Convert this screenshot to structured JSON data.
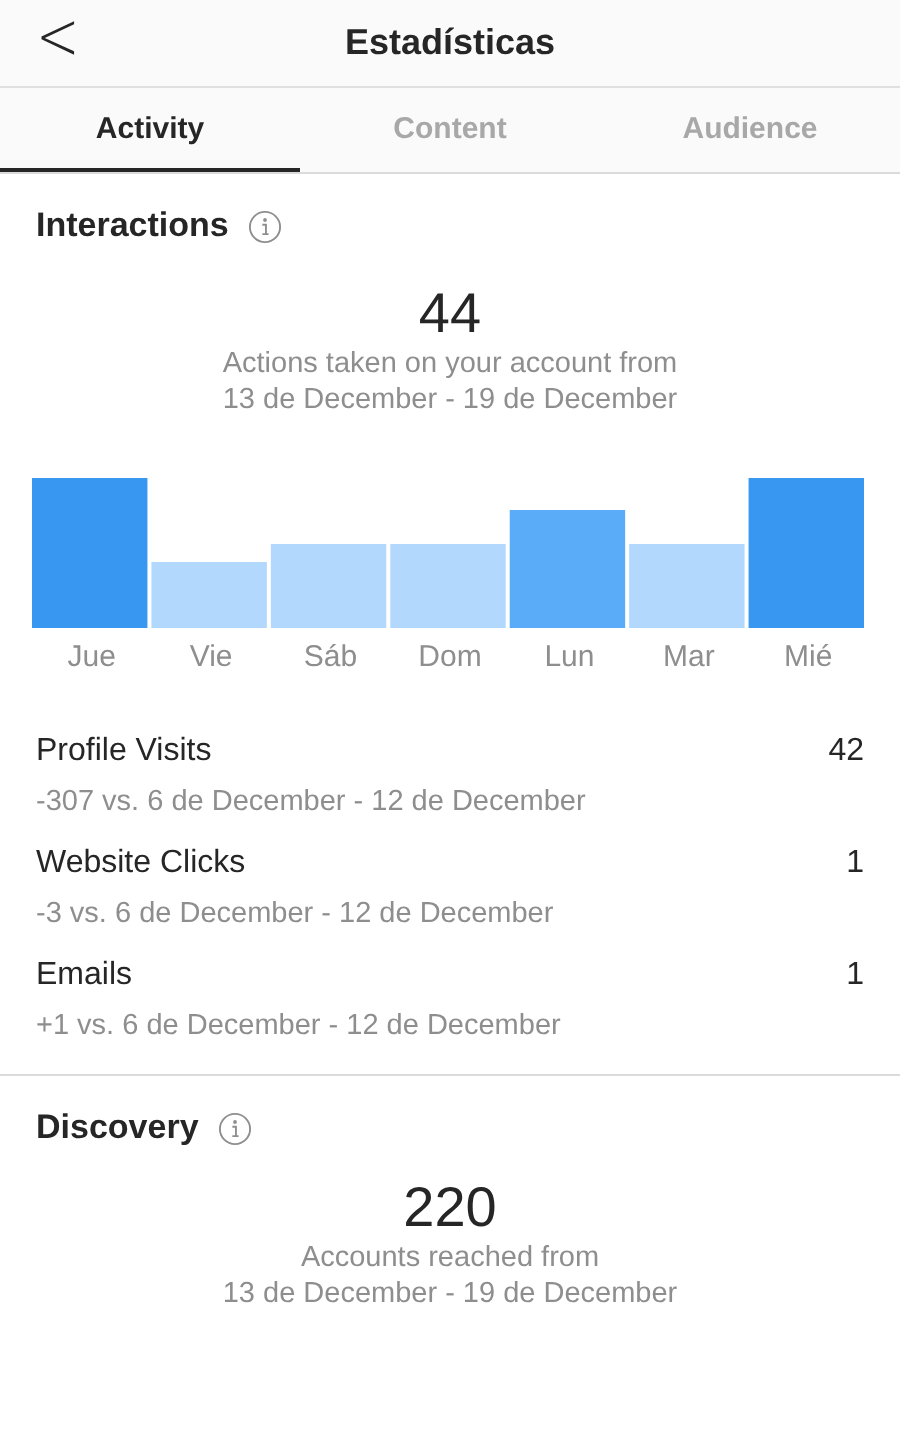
{
  "header": {
    "back": "<",
    "title": "Estadísticas"
  },
  "tabs": [
    {
      "label": "Activity",
      "selected": true
    },
    {
      "label": "Content",
      "selected": false
    },
    {
      "label": "Audience",
      "selected": false
    }
  ],
  "interactions": {
    "title": "Interactions",
    "total": "44",
    "caption": "Actions taken on your account from",
    "range": "13 de December - 19 de December",
    "days": [
      "Jue",
      "Vie",
      "Sáb",
      "Dom",
      "Lun",
      "Mar",
      "Mié"
    ]
  },
  "metrics": [
    {
      "label": "Profile Visits",
      "value": "42",
      "change": "-307 vs. 6 de December - 12 de December"
    },
    {
      "label": "Website Clicks",
      "value": "1",
      "change": "-3 vs. 6 de December - 12 de December"
    },
    {
      "label": "Emails",
      "value": "1",
      "change": "+1 vs. 6 de December - 12 de December"
    }
  ],
  "discovery": {
    "title": "Discovery",
    "total": "220",
    "caption": "Accounts reached from",
    "range": "13 de December - 19 de December"
  }
}
